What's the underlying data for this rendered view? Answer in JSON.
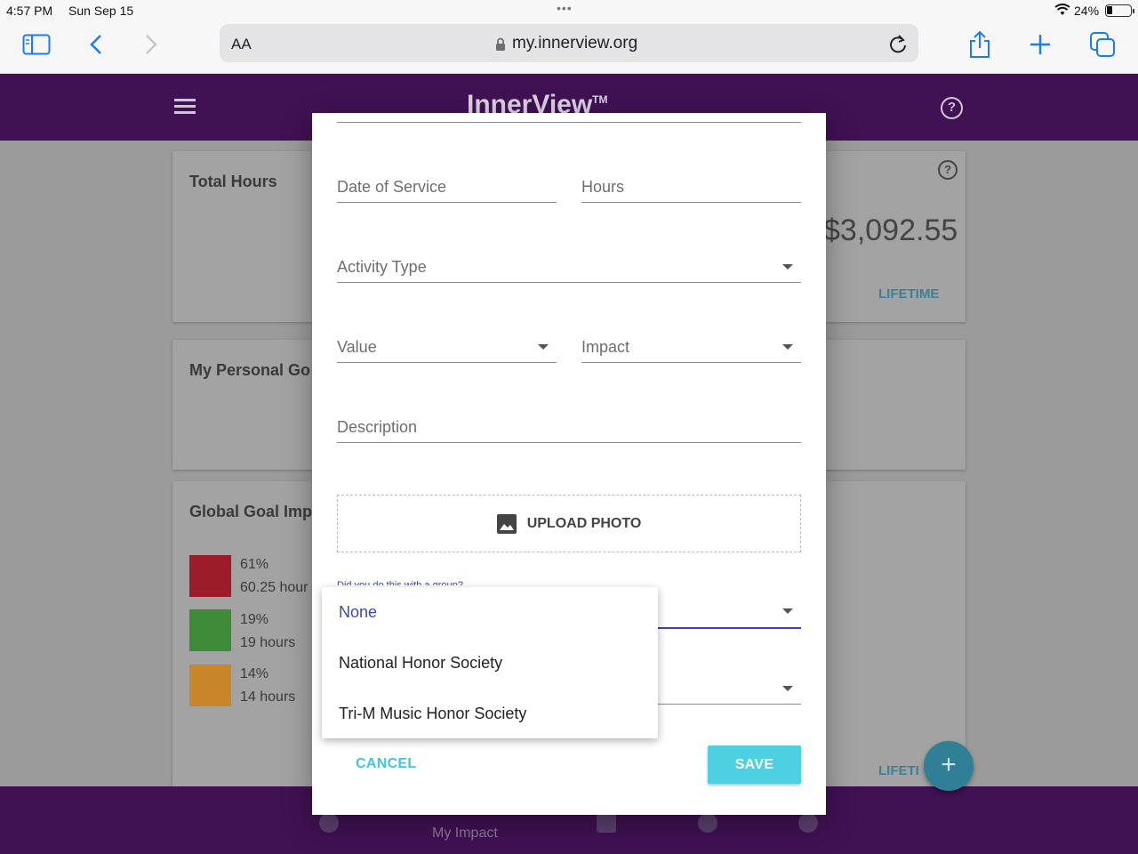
{
  "status_bar": {
    "time": "4:57 PM",
    "date": "Sun Sep 15",
    "battery": "24%"
  },
  "browser": {
    "text_size_label": "AA",
    "url": "my.innerview.org"
  },
  "app": {
    "logo": "InnerView",
    "trademark": "TM",
    "cards": {
      "total_hours": "Total Hours",
      "money_value": "$3,092.55",
      "lifetime_1": "LIFETIME",
      "personal_goals": "My Personal Go",
      "global_goal": "Global Goal Imp",
      "lifetime_2": "LIFETI"
    },
    "sdg_items": [
      {
        "percent": "61%",
        "hours": "60.25 hour",
        "color": "#9d1c2b"
      },
      {
        "percent": "19%",
        "hours": "19 hours",
        "color": "#3e8b3a"
      },
      {
        "percent": "14%",
        "hours": "14 hours",
        "color": "#c9852a"
      }
    ],
    "bottom_nav": {
      "active_label": "My Impact"
    }
  },
  "dialog": {
    "fields": {
      "date_of_service": "Date of Service",
      "hours": "Hours",
      "activity_type": "Activity Type",
      "value": "Value",
      "impact": "Impact",
      "description": "Description"
    },
    "upload_label": "UPLOAD PHOTO",
    "group_question": "Did you do this with a group?",
    "cancel": "CANCEL",
    "save": "SAVE"
  },
  "group_menu": {
    "options": [
      "None",
      "National Honor Society",
      "Tri-M Music Honor Society"
    ],
    "selected": "None"
  },
  "colors": {
    "brand_purple": "#401153",
    "accent_cyan": "#4dd0e1",
    "select_blue": "#3949ab"
  }
}
